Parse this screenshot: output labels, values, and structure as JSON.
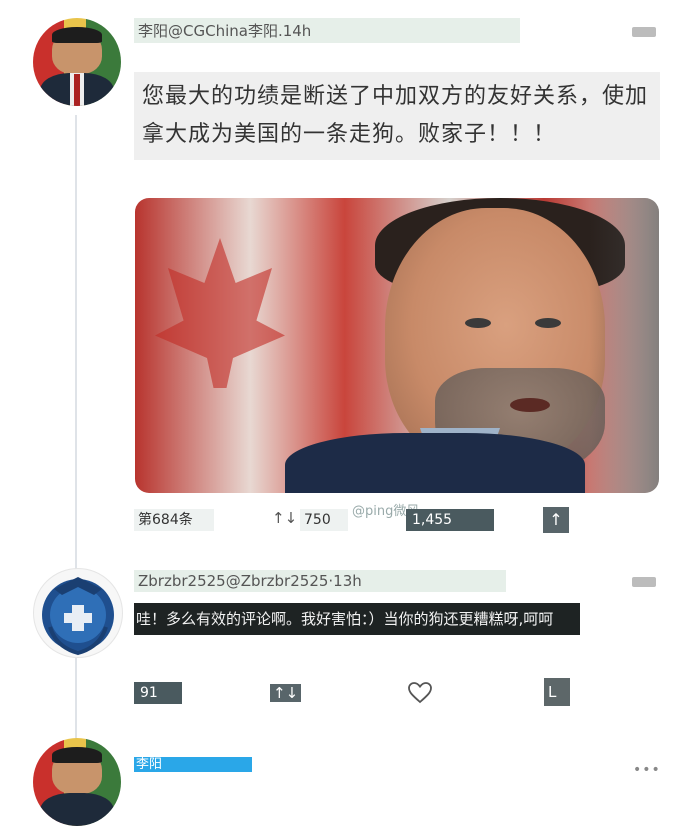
{
  "post": {
    "header": "李阳@CGChina李阳.14h",
    "text": "您最大的功绩是断送了中加双方的友好关系，使加拿大成为美国的一条走狗。败家子！！！",
    "stats": {
      "count_label": "第684条",
      "vote_count": "750",
      "like_count": "1,455"
    },
    "watermark": "@ping微风"
  },
  "reply": {
    "header": "Zbrzbr2525@Zbrzbr2525·13h",
    "text": "哇！多么有效的评论啊。我好害怕：）当你的狗还更糟糕呀,呵呵",
    "stats": {
      "reply_count": "91"
    }
  },
  "next_post": {
    "name": "李阳"
  },
  "icons": {
    "vote": "up-down-arrows-icon",
    "share": "share-up-icon",
    "heart": "heart-icon",
    "more": "more-icon"
  },
  "colors": {
    "accent_blue": "#2aa7e8",
    "dark_stat": "#4a5a5f"
  }
}
